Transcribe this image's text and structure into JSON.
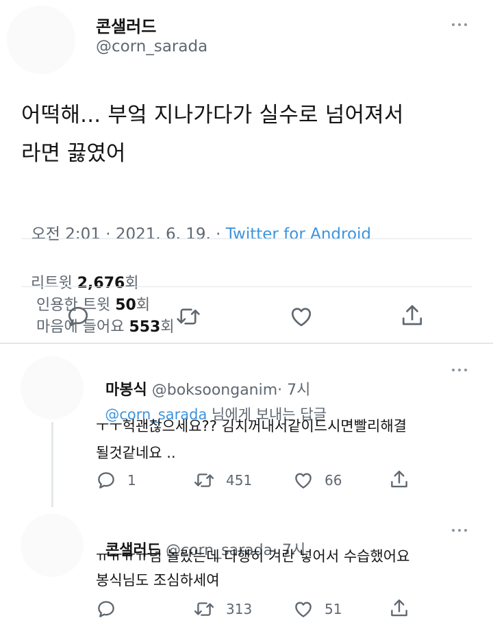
{
  "tweet": {
    "display_name": "콘샐러드",
    "handle": "@corn_sarada",
    "text_line1": "어떡해... 부엌 지나가다가 실수로 넘어져서",
    "text_line2": "라면 끓였어",
    "time": "오전 2:01 · 2021. 6. 19. · ",
    "source": "Twitter for Android",
    "stats": {
      "retweets_label": "리트윗",
      "retweets_count": "2,676",
      "quotes_label": "인용한 트윗",
      "quotes_count": "50",
      "likes_label": "마음에 들어요",
      "likes_count": "553",
      "unit": "회"
    },
    "icons": [
      "reply-icon",
      "retweet-icon",
      "like-icon",
      "share-icon"
    ]
  },
  "replies": [
    {
      "display_name": "마봉식",
      "handle": "@boksoonganim",
      "time": "· 7시",
      "replying_to_handle": "@corn_sarada",
      "replying_to_suffix": " 님에게 보내는 답글",
      "text_line1": "ㅜㅜ헉괜찮으세요?? 김치꺼내서같이드시면빨리해결",
      "text_line2": "될것같네요 ..",
      "reply_count": "1",
      "retweet_count": "451",
      "like_count": "66"
    },
    {
      "display_name": "콘샐러드",
      "handle": "@corn_sarada",
      "time": "· 7시",
      "text_line1": "ㅠㅠㅠㅠ넘 놀랐는데 다행히 겨란 넣어서 수습했어요",
      "text_line2": "봉식님도 조심하세여",
      "reply_count": "",
      "retweet_count": "313",
      "like_count": "51"
    }
  ]
}
